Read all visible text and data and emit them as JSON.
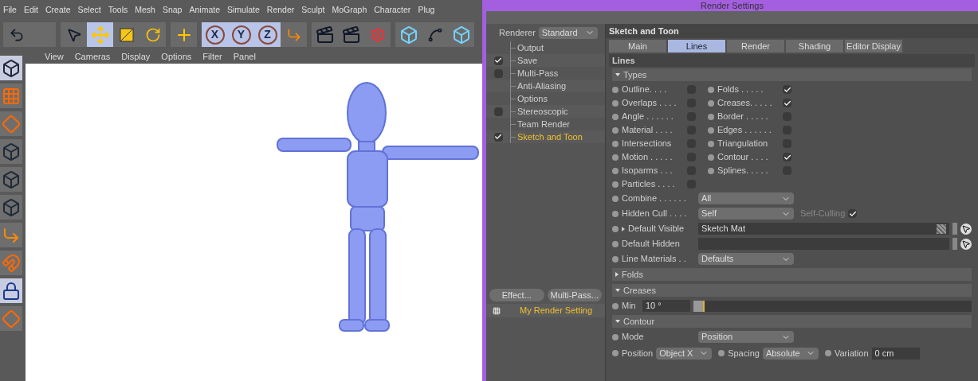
{
  "menu": [
    "File",
    "Edit",
    "Create",
    "Select",
    "Tools",
    "Mesh",
    "Snap",
    "Animate",
    "Simulate",
    "Render",
    "Sculpt",
    "MoGraph",
    "Character",
    "Plug"
  ],
  "toolbar": [
    [
      {
        "kind": "undo",
        "selected": false
      },
      {
        "kind": "blank",
        "selected": false
      }
    ],
    [
      {
        "kind": "pointer",
        "selected": false
      },
      {
        "kind": "move",
        "selected": true
      },
      {
        "kind": "scale",
        "selected": false
      },
      {
        "kind": "rotate",
        "selected": false
      }
    ],
    [
      {
        "kind": "add",
        "selected": false
      }
    ],
    [
      {
        "kind": "axis-letter",
        "label": "X",
        "selected": true
      },
      {
        "kind": "axis-letter",
        "label": "Y",
        "selected": true
      },
      {
        "kind": "axis-letter",
        "label": "Z",
        "selected": true
      },
      {
        "kind": "coords",
        "selected": false
      }
    ],
    [
      {
        "kind": "clapper",
        "selected": false
      },
      {
        "kind": "clapper",
        "selected": false
      },
      {
        "kind": "clapper-gear",
        "selected": false
      }
    ],
    [
      {
        "kind": "cube",
        "selected": false
      },
      {
        "kind": "spline",
        "selected": false
      },
      {
        "kind": "cube",
        "selected": false
      }
    ]
  ],
  "palette": [
    {
      "kind": "cube",
      "selected": true
    },
    {
      "kind": "grid",
      "selected": false
    },
    {
      "kind": "plane",
      "selected": false
    },
    {
      "kind": "cube",
      "selected": false
    },
    {
      "kind": "cube",
      "selected": false
    },
    {
      "kind": "cube",
      "selected": false
    },
    {
      "kind": "axis",
      "selected": false
    },
    {
      "kind": "magnet",
      "selected": false
    },
    {
      "kind": "lock",
      "selected": true
    },
    {
      "kind": "plane",
      "selected": false
    }
  ],
  "viewport_menu": [
    "View",
    "Cameras",
    "Display",
    "Options",
    "Filter",
    "Panel"
  ],
  "render_settings": {
    "title": "Render Settings",
    "renderer": {
      "label": "Renderer",
      "value": "Standard"
    },
    "tree": [
      {
        "label": "Output",
        "kind": "plain",
        "selected": false
      },
      {
        "label": "Save",
        "kind": "checkbox",
        "checked": true,
        "selected": false
      },
      {
        "label": "Multi-Pass",
        "kind": "checkbox",
        "checked": false,
        "selected": false
      },
      {
        "label": "Anti-Aliasing",
        "kind": "plain",
        "selected": false
      },
      {
        "label": "Options",
        "kind": "plain",
        "selected": false
      },
      {
        "label": "Stereoscopic",
        "kind": "checkbox",
        "checked": false,
        "selected": false
      },
      {
        "label": "Team Render",
        "kind": "plain",
        "selected": false
      },
      {
        "label": "Sketch and Toon",
        "kind": "checkbox",
        "checked": true,
        "selected": true
      }
    ],
    "buttons": [
      "Effect...",
      "Multi-Pass..."
    ],
    "settings": [
      {
        "label": "My Render Setting",
        "selected": true
      }
    ],
    "header": "Sketch and Toon",
    "tabs": [
      {
        "label": "Main",
        "selected": false
      },
      {
        "label": "Lines",
        "selected": true
      },
      {
        "label": "Render",
        "selected": false
      },
      {
        "label": "Shading",
        "selected": false
      },
      {
        "label": "Editor Display",
        "selected": false
      }
    ],
    "section": "Lines",
    "types": {
      "title": "Types",
      "expanded": true,
      "left": [
        {
          "label": "Outline. . . .",
          "checked": false
        },
        {
          "label": "Overlaps . . . .",
          "checked": false
        },
        {
          "label": "Angle . . . . . .",
          "checked": false
        },
        {
          "label": "Material . . . .",
          "checked": false
        },
        {
          "label": "Intersections",
          "checked": false
        },
        {
          "label": "Motion . . . . .",
          "checked": false
        },
        {
          "label": "Isoparms . . .",
          "checked": false
        },
        {
          "label": "Particles . . . .",
          "checked": false
        }
      ],
      "right": [
        {
          "label": "Folds . .  . . .",
          "checked": true
        },
        {
          "label": "Creases. . . . .",
          "checked": true
        },
        {
          "label": "Border . . . . .",
          "checked": false
        },
        {
          "label": "Edges . . . . . .",
          "checked": false
        },
        {
          "label": "Triangulation",
          "checked": false
        },
        {
          "label": "Contour . . . .",
          "checked": true
        },
        {
          "label": "Splines. . . . .",
          "checked": false
        }
      ]
    },
    "params": [
      {
        "kind": "dropdown",
        "label": "Combine . . . . . .",
        "value": "All"
      },
      {
        "kind": "dropdown",
        "label": "Hidden Cull . . . .",
        "value": "Self",
        "option": {
          "label": "Self-Culling",
          "checked": true
        }
      },
      {
        "kind": "link",
        "label": "Default Visible",
        "value": "Sketch Mat",
        "expandable": true
      },
      {
        "kind": "link",
        "label": "Default Hidden",
        "expandable": false
      },
      {
        "kind": "dropdown",
        "label": "Line Materials . .",
        "value": "Defaults"
      }
    ],
    "groups": [
      {
        "title": "Folds",
        "expanded": false
      },
      {
        "title": "Creases",
        "expanded": true,
        "params": [
          {
            "kind": "slider",
            "label": "Min",
            "value": "10 °",
            "level": 0.04
          }
        ]
      },
      {
        "title": "Contour",
        "expanded": true,
        "params": [
          {
            "kind": "dropdown",
            "label": "Mode",
            "value": "Position"
          },
          {
            "kind": "multi",
            "items": [
              {
                "label": "Position",
                "value": "Object X",
                "kind": "dropdown"
              },
              {
                "label": "Spacing",
                "value": "Absolute",
                "kind": "dropdown"
              },
              {
                "label": "Variation",
                "value": "0 cm",
                "kind": "spinner"
              }
            ]
          }
        ]
      }
    ]
  }
}
